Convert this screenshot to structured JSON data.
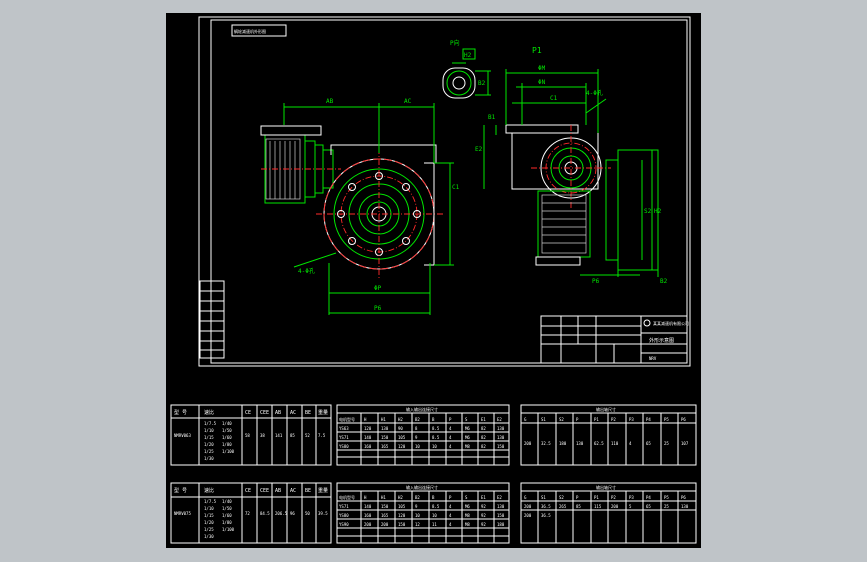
{
  "colors": {
    "background": "#bfc4c8",
    "sheet": "#000000",
    "lines": "#00e600",
    "outline": "#ffffff",
    "centerline": "#ff2a2a",
    "hatch": "#ff3cff"
  },
  "drawing": {
    "header_block": "蜗轮减速机外形图",
    "p_view_label": "P向",
    "p1_label": "P1",
    "dims": {
      "ab": "AB",
      "ac": "AC",
      "c1": "C1",
      "phi_p": "ΦP",
      "p6": "P6",
      "holes_left": "4-Φ孔",
      "holes_right": "4-Φ孔",
      "phi_m": "ΦM",
      "phi_n": "ΦN",
      "c1_right": "C1",
      "w": "W",
      "e2": "E2",
      "s2": "S2",
      "h2": "H2",
      "p6_right": "P6",
      "h2_p": "H2",
      "b2": "B2",
      "b1": "B1",
      "b2b": "B2"
    },
    "title_block": {
      "title": "外形示意图",
      "company": "某某减速机有限公司",
      "code": "NRV"
    }
  },
  "tables": {
    "t1": {
      "headers": [
        "型 号",
        "速比",
        "CE",
        "CEE",
        "AB",
        "AC",
        "BE",
        "重量"
      ],
      "model": "NMRV063",
      "ratios": [
        "1/7.5",
        "1/10",
        "1/15",
        "1/20",
        "1/25",
        "1/30"
      ],
      "ratios2": [
        "1/40",
        "1/50",
        "1/60",
        "1/80",
        "1/100",
        ""
      ],
      "values": [
        "58",
        "38",
        "141",
        "85",
        "52",
        "7.5"
      ]
    },
    "t2": {
      "title": "输入输出连接尺寸",
      "headers": [
        "电机型号",
        "H",
        "H1",
        "H2",
        "B2",
        "B",
        "P",
        "S",
        "E1",
        "E2"
      ],
      "rows": [
        [
          "YS63",
          "120",
          "130",
          "90",
          "8",
          "8.5",
          "4",
          "M6",
          "82",
          "130"
        ],
        [
          "YS71",
          "140",
          "150",
          "105",
          "9",
          "8.5",
          "4",
          "M6",
          "82",
          "130"
        ],
        [
          "YS80",
          "160",
          "165",
          "120",
          "10",
          "10",
          "4",
          "M8",
          "82",
          "150"
        ]
      ]
    },
    "t3": {
      "title": "输出轴尺寸",
      "headers": [
        "G",
        "S1",
        "S2",
        "P",
        "P1",
        "P2",
        "P3",
        "P4",
        "P5",
        "P6"
      ],
      "values": [
        "200",
        "32.5",
        "180",
        "130",
        "62.5",
        "110",
        "4",
        "65",
        "25",
        "107"
      ]
    },
    "t4": {
      "headers": [
        "型 号",
        "速比",
        "CE",
        "CEE",
        "AB",
        "AC",
        "BE",
        "重量"
      ],
      "model": "NMRV075",
      "ratios": [
        "1/7.5",
        "1/10",
        "1/15",
        "1/20",
        "1/25",
        "1/30"
      ],
      "ratios2": [
        "1/40",
        "1/50",
        "1/60",
        "1/80",
        "1/100",
        ""
      ],
      "values": [
        "72",
        "84.5",
        "206.5",
        "96",
        "50",
        "39.5"
      ]
    },
    "t5": {
      "title": "输入输出连接尺寸",
      "headers": [
        "电机型号",
        "H",
        "H1",
        "H2",
        "B2",
        "B",
        "P",
        "S",
        "E1",
        "E2"
      ],
      "rows": [
        [
          "YS71",
          "140",
          "150",
          "105",
          "9",
          "8.5",
          "4",
          "M6",
          "92",
          "130"
        ],
        [
          "YS80",
          "160",
          "165",
          "120",
          "10",
          "10",
          "4",
          "M8",
          "92",
          "150"
        ],
        [
          "YS90",
          "200",
          "200",
          "150",
          "12",
          "11",
          "4",
          "M8",
          "92",
          "180"
        ]
      ]
    },
    "t6": {
      "title": "输出轴尺寸",
      "headers": [
        "G",
        "S1",
        "S2",
        "P",
        "P1",
        "P2",
        "P3",
        "P4",
        "P5",
        "P6"
      ],
      "rows": [
        [
          "200",
          "36.5",
          "265",
          "85",
          "115",
          "200",
          "5",
          "65",
          "25",
          "130"
        ],
        [
          "200",
          "36.5",
          "",
          "",
          "",
          "",
          "",
          "",
          "",
          ""
        ]
      ]
    }
  }
}
